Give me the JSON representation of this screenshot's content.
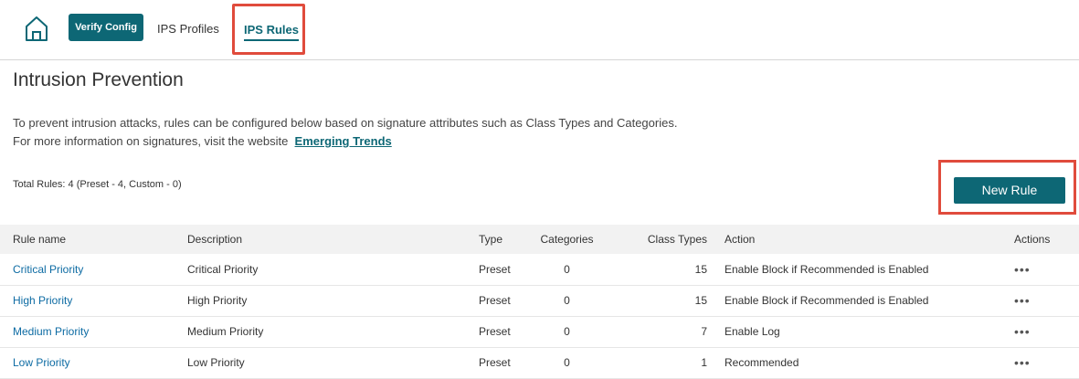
{
  "nav": {
    "verify_label": "Verify Config",
    "tabs": [
      {
        "label": "IPS Profiles"
      },
      {
        "label": "IPS Rules"
      }
    ]
  },
  "page": {
    "title": "Intrusion Prevention",
    "desc_line1": "To prevent intrusion attacks, rules can be configured below based on signature attributes such as Class Types and Categories.",
    "desc_line2": "For more information on signatures, visit the website",
    "link_label": "Emerging Trends",
    "total": "Total Rules: 4 (Preset - 4, Custom - 0)",
    "new_rule_label": "New Rule"
  },
  "table": {
    "headers": [
      "Rule name",
      "Description",
      "Type",
      "Categories",
      "Class Types",
      "Action",
      "Actions"
    ],
    "rows": [
      {
        "name": "Critical Priority",
        "description": "Critical Priority",
        "type": "Preset",
        "categories": "0",
        "class_types": "15",
        "action": "Enable Block if Recommended is Enabled"
      },
      {
        "name": "High Priority",
        "description": "High Priority",
        "type": "Preset",
        "categories": "0",
        "class_types": "15",
        "action": "Enable Block if Recommended is Enabled"
      },
      {
        "name": "Medium Priority",
        "description": "Medium Priority",
        "type": "Preset",
        "categories": "0",
        "class_types": "7",
        "action": "Enable Log"
      },
      {
        "name": "Low Priority",
        "description": "Low Priority",
        "type": "Preset",
        "categories": "0",
        "class_types": "1",
        "action": "Recommended"
      }
    ],
    "row_menu_glyph": "•••"
  },
  "colors": {
    "accent": "#0d6775",
    "link": "#0d6ba3",
    "highlight": "#e04b3c"
  }
}
